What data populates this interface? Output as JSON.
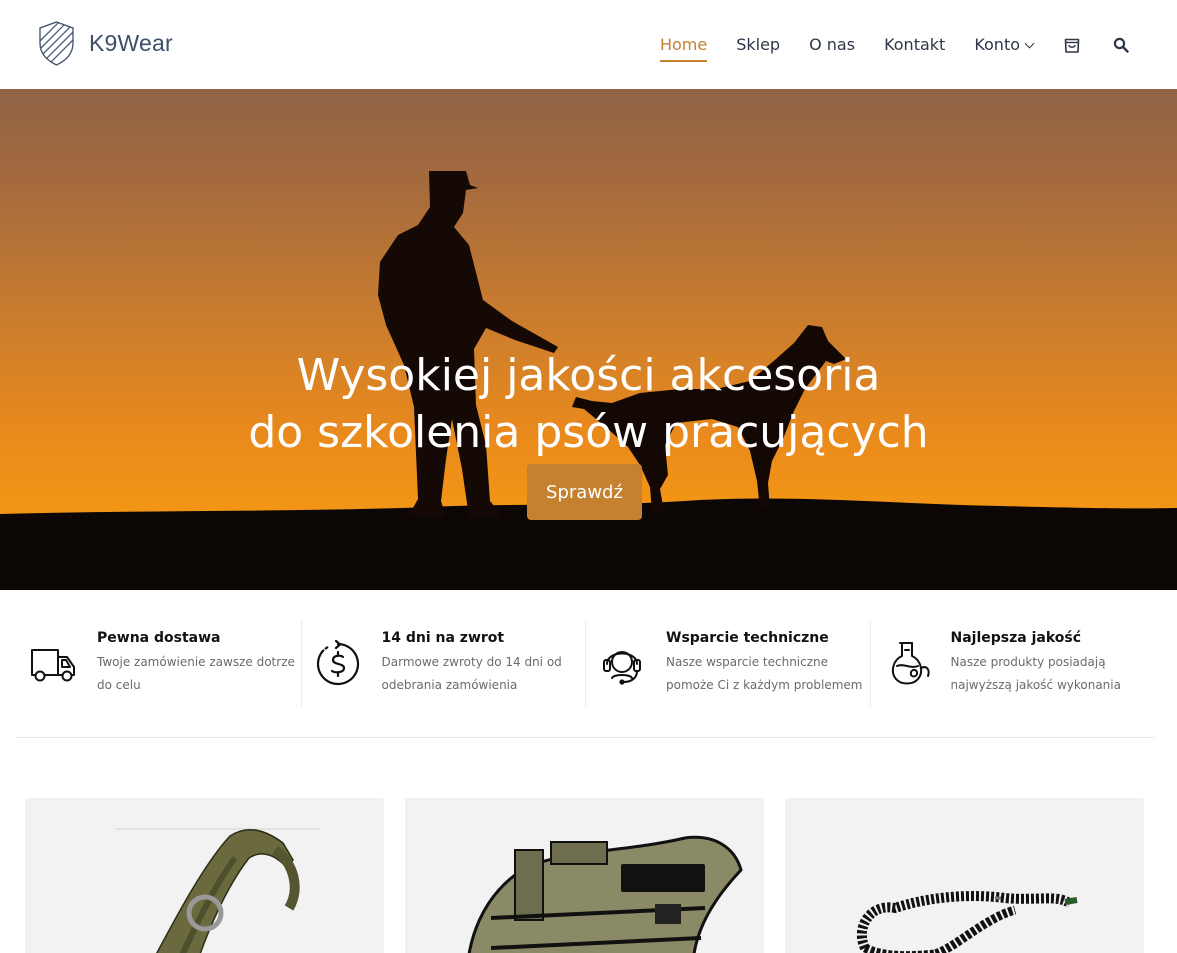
{
  "brand": {
    "name": "K9Wear",
    "logo_icon": "shield-stripes-icon"
  },
  "nav": {
    "items": [
      {
        "label": "Home",
        "active": true
      },
      {
        "label": "Sklep",
        "active": false
      },
      {
        "label": "O nas",
        "active": false
      },
      {
        "label": "Kontakt",
        "active": false
      },
      {
        "label": "Konto",
        "active": false,
        "has_dropdown": true
      }
    ],
    "cart_icon": "shopping-bag-icon",
    "search_icon": "search-icon"
  },
  "hero": {
    "title_line1": "Wysokiej jakości akcesoria",
    "title_line2": "do szkolenia psów pracujących",
    "cta_label": "Sprawdź",
    "image": "soldier-and-dog-silhouette-at-sunset"
  },
  "features": [
    {
      "icon": "delivery-truck-icon",
      "title": "Pewna dostawa",
      "desc": "Twoje zamówienie zawsze dotrze do celu"
    },
    {
      "icon": "money-return-icon",
      "title": "14 dni na zwrot",
      "desc": "Darmowe zwroty do 14 dni od odebrania zamówienia"
    },
    {
      "icon": "headset-support-icon",
      "title": "Wsparcie techniczne",
      "desc": "Nasze wsparcie techniczne pomoże Ci z każdym problemem"
    },
    {
      "icon": "quality-flask-icon",
      "title": "Najlepsza jakość",
      "desc": "Nasze produkty posiadają najwyższą jakość wykonania"
    }
  ],
  "products": [
    {
      "image": "olive-tactical-dog-collar"
    },
    {
      "image": "olive-k9-tactical-dog-vest"
    },
    {
      "image": "black-bungee-dog-leash"
    }
  ],
  "colors": {
    "accent": "#c5812f",
    "text": "#2d3748",
    "hero_sky_top": "#8f6346",
    "hero_sky_bottom": "#f29416"
  }
}
